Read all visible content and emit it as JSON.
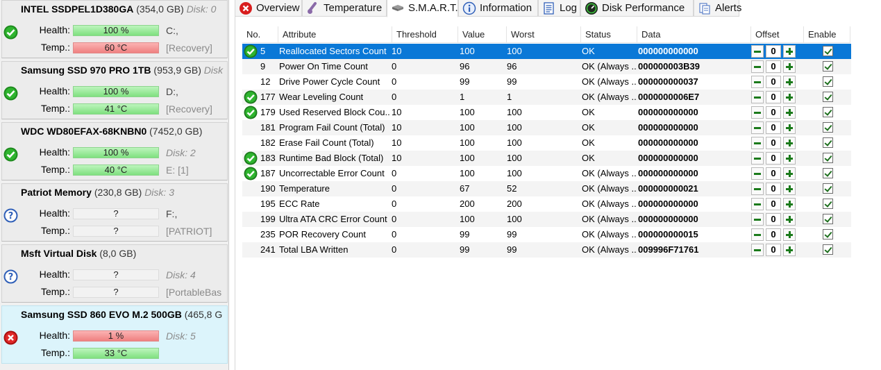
{
  "disks": [
    {
      "name": "INTEL SSDPEL1D380GA",
      "capacity": "(354,0 GB)",
      "tag": "Disk: 0",
      "status": "good",
      "health_label": "Health:",
      "health": "100 %",
      "health_color": "green",
      "temp_label": "Temp.:",
      "temp": "60 °C",
      "temp_color": "red",
      "side_health": "C:,",
      "side_temp": "[Recovery]"
    },
    {
      "name": "Samsung SSD 970 PRO 1TB",
      "capacity": "(953,9 GB)",
      "tag": "Disk",
      "status": "good",
      "health_label": "Health:",
      "health": "100 %",
      "health_color": "green",
      "temp_label": "Temp.:",
      "temp": "41 °C",
      "temp_color": "green",
      "side_health": "D:,",
      "side_temp": "[Recovery]"
    },
    {
      "name": "WDC WD80EFAX-68KNBN0",
      "capacity": "(7452,0 GB)",
      "tag": "",
      "status": "good",
      "health_label": "Health:",
      "health": "100 %",
      "health_color": "green",
      "temp_label": "Temp.:",
      "temp": "40 °C",
      "temp_color": "green",
      "side_health": "Disk: 2",
      "side_temp": "E: [1]"
    },
    {
      "name": "Patriot Memory",
      "capacity": "(230,8 GB)",
      "tag": "Disk: 3",
      "status": "unknown",
      "health_label": "Health:",
      "health": "?",
      "health_color": "none",
      "temp_label": "Temp.:",
      "temp": "?",
      "temp_color": "none",
      "side_health": "F:,",
      "side_temp": "[PATRIOT]"
    },
    {
      "name": "Msft    Virtual Disk",
      "capacity": "(8,0 GB)",
      "tag": "",
      "status": "unknown",
      "health_label": "Health:",
      "health": "?",
      "health_color": "none",
      "temp_label": "Temp.:",
      "temp": "?",
      "temp_color": "none",
      "side_health": "Disk: 4",
      "side_temp": "[PortableBas"
    },
    {
      "name": "Samsung SSD 860 EVO M.2 500GB",
      "capacity": "(465,8 G",
      "tag": "",
      "status": "bad",
      "health_label": "Health:",
      "health": "1 %",
      "health_color": "red",
      "temp_label": "Temp.:",
      "temp": "33 °C",
      "temp_color": "green",
      "side_health": "Disk: 5",
      "side_temp": ""
    }
  ],
  "tabs": [
    {
      "label": "Overview",
      "icon": "error-icon"
    },
    {
      "label": "Temperature",
      "icon": "thermometer-icon"
    },
    {
      "label": "S.M.A.R.T.",
      "icon": "drive-icon"
    },
    {
      "label": "Information",
      "icon": "info-icon"
    },
    {
      "label": "Log",
      "icon": "log-icon"
    },
    {
      "label": "Disk Performance",
      "icon": "performance-icon"
    },
    {
      "label": "Alerts",
      "icon": "alerts-icon"
    }
  ],
  "columns": [
    "No.",
    "Attribute",
    "Threshold",
    "Value",
    "Worst",
    "Status",
    "Data",
    "Offset",
    "Enable"
  ],
  "rows": [
    {
      "no": "5",
      "attr": "Reallocated Sectors Count",
      "thr": "10",
      "val": "100",
      "worst": "100",
      "status": "OK",
      "data": "000000000000",
      "offset": "0",
      "ok_icon": true
    },
    {
      "no": "9",
      "attr": "Power On Time Count",
      "thr": "0",
      "val": "96",
      "worst": "96",
      "status": "OK (Always ...",
      "data": "000000003B39",
      "offset": "0",
      "ok_icon": false
    },
    {
      "no": "12",
      "attr": "Drive Power Cycle Count",
      "thr": "0",
      "val": "99",
      "worst": "99",
      "status": "OK (Always ...",
      "data": "000000000037",
      "offset": "0",
      "ok_icon": false
    },
    {
      "no": "177",
      "attr": "Wear Leveling Count",
      "thr": "0",
      "val": "1",
      "worst": "1",
      "status": "OK (Always ...",
      "data": "0000000006E7",
      "offset": "0",
      "ok_icon": true
    },
    {
      "no": "179",
      "attr": "Used Reserved Block Cou...",
      "thr": "10",
      "val": "100",
      "worst": "100",
      "status": "OK",
      "data": "000000000000",
      "offset": "0",
      "ok_icon": true
    },
    {
      "no": "181",
      "attr": "Program Fail Count (Total)",
      "thr": "10",
      "val": "100",
      "worst": "100",
      "status": "OK",
      "data": "000000000000",
      "offset": "0",
      "ok_icon": false
    },
    {
      "no": "182",
      "attr": "Erase Fail Count (Total)",
      "thr": "10",
      "val": "100",
      "worst": "100",
      "status": "OK",
      "data": "000000000000",
      "offset": "0",
      "ok_icon": false
    },
    {
      "no": "183",
      "attr": "Runtime Bad Block (Total)",
      "thr": "10",
      "val": "100",
      "worst": "100",
      "status": "OK",
      "data": "000000000000",
      "offset": "0",
      "ok_icon": true
    },
    {
      "no": "187",
      "attr": "Uncorrectable Error Count",
      "thr": "0",
      "val": "100",
      "worst": "100",
      "status": "OK (Always ...",
      "data": "000000000000",
      "offset": "0",
      "ok_icon": true
    },
    {
      "no": "190",
      "attr": "Temperature",
      "thr": "0",
      "val": "67",
      "worst": "52",
      "status": "OK (Always ...",
      "data": "000000000021",
      "offset": "0",
      "ok_icon": false
    },
    {
      "no": "195",
      "attr": "ECC Rate",
      "thr": "0",
      "val": "200",
      "worst": "200",
      "status": "OK (Always ...",
      "data": "000000000000",
      "offset": "0",
      "ok_icon": false
    },
    {
      "no": "199",
      "attr": "Ultra ATA CRC Error Count",
      "thr": "0",
      "val": "100",
      "worst": "100",
      "status": "OK (Always ...",
      "data": "000000000000",
      "offset": "0",
      "ok_icon": false
    },
    {
      "no": "235",
      "attr": "POR Recovery Count",
      "thr": "0",
      "val": "99",
      "worst": "99",
      "status": "OK (Always ...",
      "data": "000000000015",
      "offset": "0",
      "ok_icon": false
    },
    {
      "no": "241",
      "attr": "Total LBA Written",
      "thr": "0",
      "val": "99",
      "worst": "99",
      "status": "OK (Always ...",
      "data": "009996F71761",
      "offset": "0",
      "ok_icon": false
    }
  ],
  "colors": {
    "selected_row": "#0a78d7",
    "ok_green": "#1e8a1e",
    "bad_red": "#d81e1e",
    "unknown_blue": "#2f5fb8"
  }
}
